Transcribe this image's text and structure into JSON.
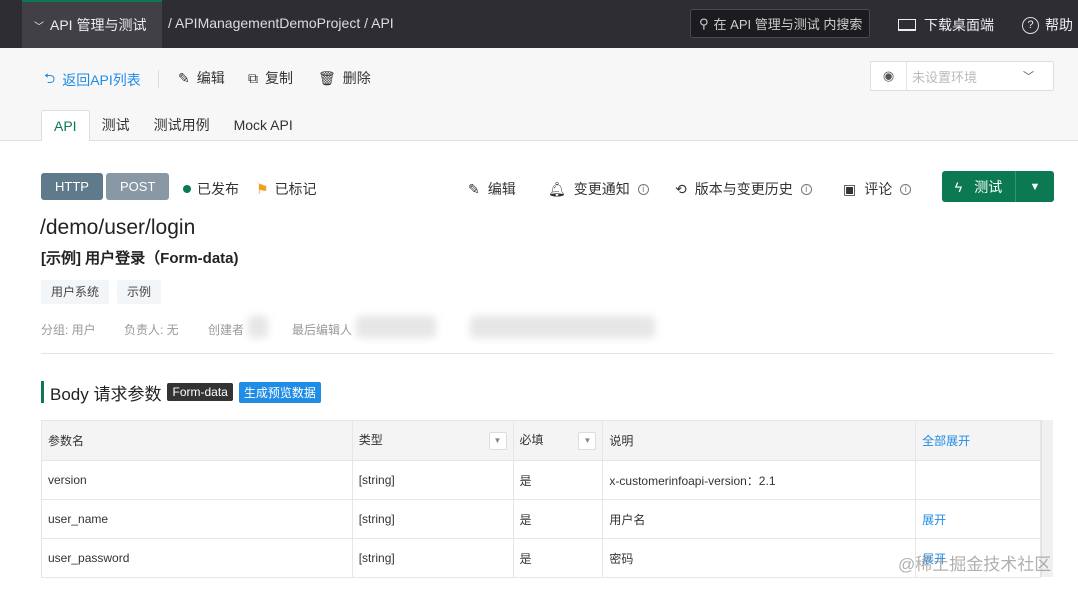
{
  "topbar": {
    "project": "API 管理与测试",
    "breadcrumb": "/ APIManagementDemoProject / API",
    "search_placeholder": "在 API 管理与测试 内搜索",
    "download": "下载桌面端",
    "help": "帮助"
  },
  "toolbar": {
    "back": "返回API列表",
    "edit": "编辑",
    "copy": "复制",
    "delete": "删除",
    "env_placeholder": "未设置环境"
  },
  "tabs": [
    "API",
    "测试",
    "测试用例",
    "Mock API"
  ],
  "api": {
    "protocol": "HTTP",
    "method": "POST",
    "status": "已发布",
    "marked": "已标记",
    "path": "/demo/user/login",
    "name": "[示例] 用户登录（Form-data)",
    "tags": [
      "用户系统",
      "示例"
    ],
    "group": "分组: 用户",
    "owner": "负责人: 无",
    "creator": "创建者",
    "last_editor": "最后编辑人"
  },
  "actions": {
    "edit": "编辑",
    "notify": "变更通知",
    "history": "版本与变更历史",
    "comment": "评论",
    "test": "测试"
  },
  "body": {
    "title": "Body 请求参数",
    "format": "Form-data",
    "generate": "生成预览数据",
    "headers": [
      "参数名",
      "类型",
      "必填",
      "说明",
      "全部展开"
    ],
    "rows": [
      {
        "name": "version",
        "type": "[string]",
        "required": "是",
        "desc": "x-customerinfoapi-version：2.1",
        "action": ""
      },
      {
        "name": "user_name",
        "type": "[string]",
        "required": "是",
        "desc": "用户名",
        "action": "展开"
      },
      {
        "name": "user_password",
        "type": "[string]",
        "required": "是",
        "desc": "密码",
        "action": "展开"
      }
    ]
  },
  "watermark": "@稀土掘金技术社区",
  "colors": {
    "brand": "#0b7a52",
    "link": "#1f8ce6",
    "flag": "#f0a020"
  }
}
